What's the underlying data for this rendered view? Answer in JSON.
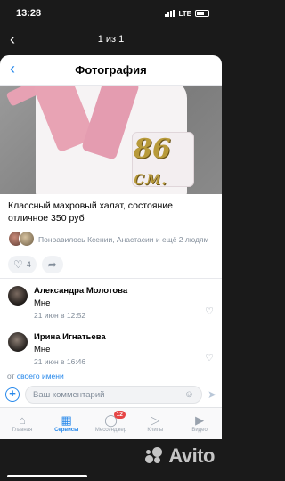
{
  "status": {
    "time": "13:28",
    "network": "LTE"
  },
  "viewer": {
    "counter": "1 из 1"
  },
  "card": {
    "title": "Фотография",
    "photo_labels": {
      "number": "86",
      "unit": "см."
    },
    "description": "Классный махровый халат, состояние отличное 350 руб",
    "likes_text": "Понравилось Ксении, Анастасии и ещё 2 людям",
    "like_count": "4",
    "comments": [
      {
        "author": "Александра Молотова",
        "text": "Мне",
        "date": "21 июн в 12:52"
      },
      {
        "author": "Ирина Игнатьева",
        "text": "Мне",
        "date": "21 июн в 16:46"
      }
    ]
  },
  "from_line": {
    "prefix": "от",
    "link": "своего имени"
  },
  "composer": {
    "placeholder": "Ваш комментарий"
  },
  "tabbar": {
    "items": [
      {
        "label": "Главная",
        "icon": "home-icon"
      },
      {
        "label": "Сервисы",
        "icon": "services-icon",
        "active": true
      },
      {
        "label": "Мессенджер",
        "icon": "messenger-icon",
        "badge": "12"
      },
      {
        "label": "Клипы",
        "icon": "clips-icon"
      },
      {
        "label": "Видео",
        "icon": "video-icon"
      }
    ]
  },
  "watermark": {
    "text": "Avito"
  },
  "colors": {
    "accent": "#2688eb",
    "badge": "#e64646",
    "secondary_text": "#818c99"
  }
}
